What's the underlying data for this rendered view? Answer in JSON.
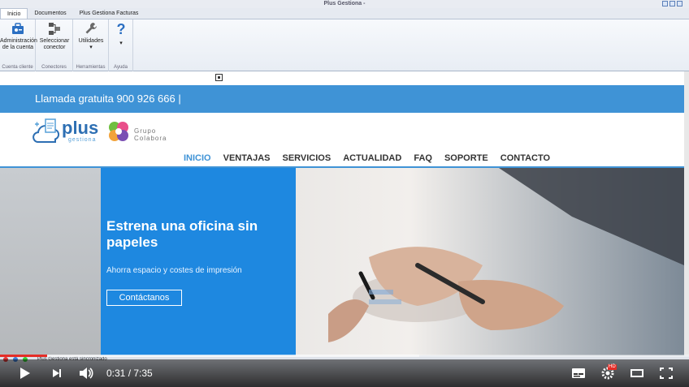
{
  "window": {
    "title": "Plus Gestiona -"
  },
  "ribbon": {
    "tabs": [
      {
        "label": "Inicio",
        "active": true
      },
      {
        "label": "Documentos",
        "active": false
      },
      {
        "label": "Plus Gestiona Facturas",
        "active": false
      }
    ],
    "groups": [
      {
        "caption": "Cuenta cliente",
        "buttons": [
          {
            "label_line1": "Administración",
            "label_line2": "de la cuenta",
            "icon": "account-admin-icon"
          }
        ]
      },
      {
        "caption": "Conectores",
        "buttons": [
          {
            "label_line1": "Seleccionar",
            "label_line2": "conector",
            "icon": "connector-icon"
          }
        ]
      },
      {
        "caption": "Herramientas",
        "buttons": [
          {
            "label_line1": "Utilidades",
            "label_line2": "▾",
            "icon": "wrench-icon"
          }
        ]
      },
      {
        "caption": "Ayuda",
        "buttons": [
          {
            "label_line1": "?",
            "label_line2": "▾",
            "icon": "help-icon"
          }
        ]
      }
    ]
  },
  "site": {
    "phone": "Llamada gratuita 900 926 666 |",
    "logo": {
      "main": "plus",
      "sub": "gestiona"
    },
    "partner": {
      "line1": "Grupo",
      "line2": "Colabora"
    },
    "nav": [
      {
        "label": "INICIO",
        "active": true
      },
      {
        "label": "VENTAJAS",
        "active": false
      },
      {
        "label": "SERVICIOS",
        "active": false
      },
      {
        "label": "ACTUALIDAD",
        "active": false
      },
      {
        "label": "FAQ",
        "active": false
      },
      {
        "label": "SOPORTE",
        "active": false
      },
      {
        "label": "CONTACTO",
        "active": false
      }
    ],
    "hero": {
      "title": "Estrena una oficina sin papeles",
      "subtitle": "Ahorra espacio y costes de impresión",
      "cta": "Contáctanos"
    }
  },
  "statusbar": {
    "text": "Plus Gestiona está sincronizado"
  },
  "player": {
    "time": "0:31 / 7:35",
    "progress_fraction": 0.068,
    "hd_badge": "HD"
  },
  "colors": {
    "accent": "#3f93d6",
    "hero_panel": "#1e88e0",
    "progress": "#e52d27"
  }
}
